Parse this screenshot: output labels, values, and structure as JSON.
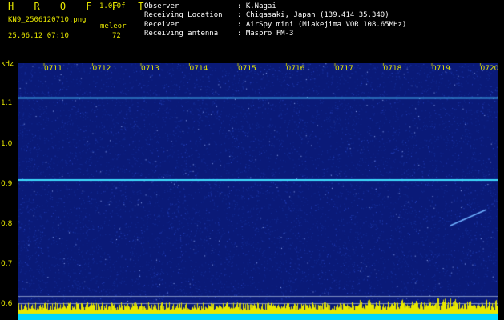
{
  "header": {
    "brand": "H R O F F T",
    "version": "1.0.0f",
    "filename": "KN9_2506120710.png",
    "kind_label": "meleor",
    "datetime": "25.06.12 07:10",
    "count": "72",
    "info": [
      {
        "key": "Observer",
        "value": ": K.Nagai"
      },
      {
        "key": "Receiving Location",
        "value": ": Chigasaki, Japan (139.414 35.340)"
      },
      {
        "key": "Receiver",
        "value": ": AirSpy mini (Miakejima VOR 108.65MHz)"
      },
      {
        "key": "Receiving antenna",
        "value": ": Maspro FM-3"
      }
    ]
  },
  "plot": {
    "unit_label": "kHz",
    "time_ticks": [
      "0711",
      "0712",
      "0713",
      "0714",
      "0715",
      "0716",
      "0717",
      "0718",
      "0719",
      "0720"
    ],
    "freq_ticks": [
      "1.1",
      "1.0",
      "0.9",
      "0.8",
      "0.7",
      "0.6"
    ],
    "colors": {
      "background": "#0a1a78",
      "noise": "#3050d0",
      "line": "#40e0ff",
      "histogram": "#e8e800",
      "base": "#00d8ff"
    }
  }
}
